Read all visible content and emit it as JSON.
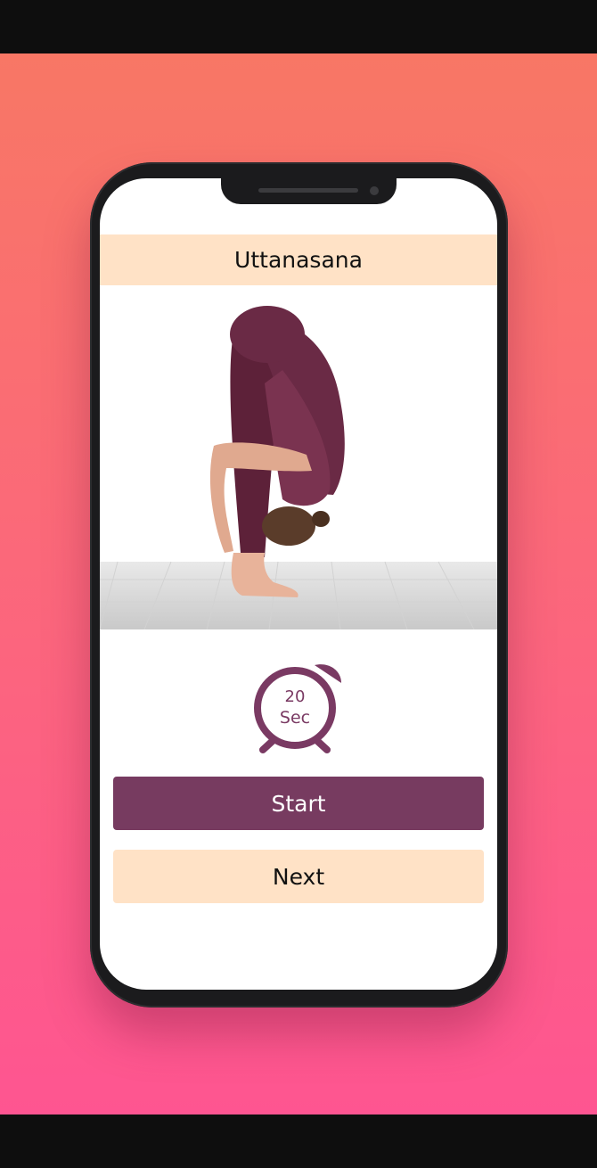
{
  "pose": {
    "title": "Uttanasana"
  },
  "timer": {
    "value": "20",
    "unit": "Sec",
    "icon": "alarm-clock-icon"
  },
  "actions": {
    "start_label": "Start",
    "next_label": "Next"
  },
  "colors": {
    "accent": "#773b60",
    "highlight": "#ffe2c6",
    "gradient_top": "#f87765",
    "gradient_bottom": "#fe5591"
  }
}
